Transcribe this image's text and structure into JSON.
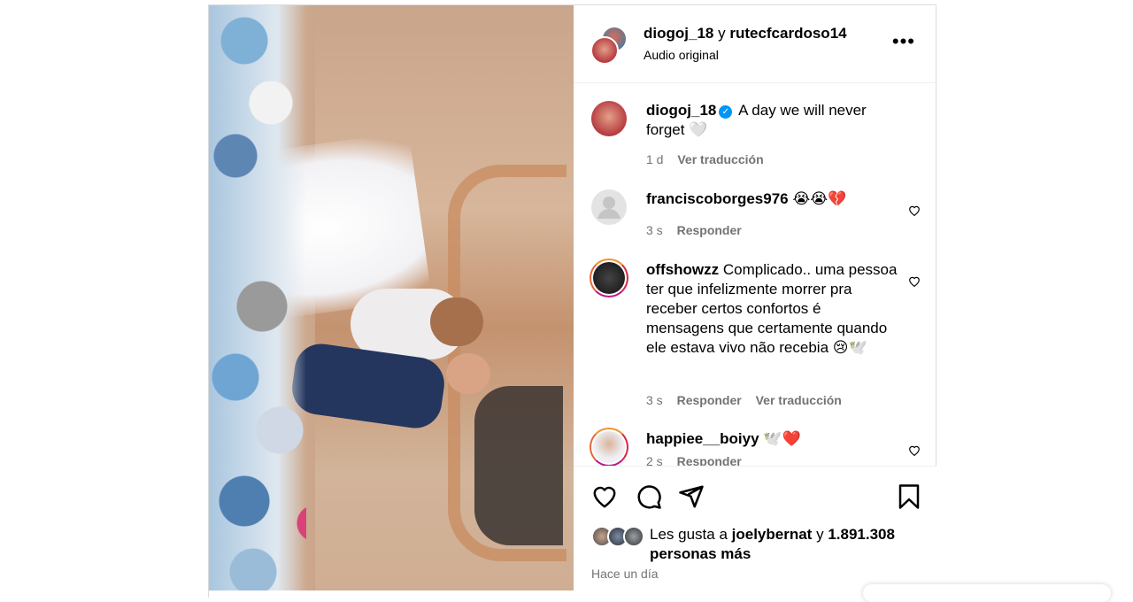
{
  "header": {
    "user1": "diogoj_18",
    "connector": "y",
    "user2": "rutecfcardoso14",
    "audio": "Audio original",
    "more_label": "•••"
  },
  "caption": {
    "user": "diogoj_18",
    "text": "A day we will never forget 🤍",
    "time": "1 d",
    "translate": "Ver traducción"
  },
  "comments": [
    {
      "user": "franciscoborges976",
      "text": "😭😭💔",
      "time": "3 s",
      "reply": "Responder"
    },
    {
      "user": "offshowzz",
      "text": "Complicado.. uma pessoa ter que infelizmente morrer pra receber certos confortos é mensagens que certamente quando ele estava vivo não recebia 😢🕊️",
      "time": "3 s",
      "reply": "Responder",
      "translate": "Ver traducción"
    },
    {
      "user": "happiee__boiyy",
      "text": "🕊️❤️",
      "time": "2 s",
      "reply": "Responder"
    }
  ],
  "likes": {
    "prefix": "Les gusta a",
    "user": "joelybernat",
    "connector": "y",
    "count": "1.891.308",
    "suffix": "personas más"
  },
  "posted": "Hace un día",
  "colors": {
    "verified": "#0095f6",
    "meta_gray": "#737373",
    "border": "#dbdbdb"
  },
  "icons": [
    "heart-icon",
    "comment-icon",
    "share-icon",
    "bookmark-icon",
    "more-icon",
    "verified-icon"
  ]
}
